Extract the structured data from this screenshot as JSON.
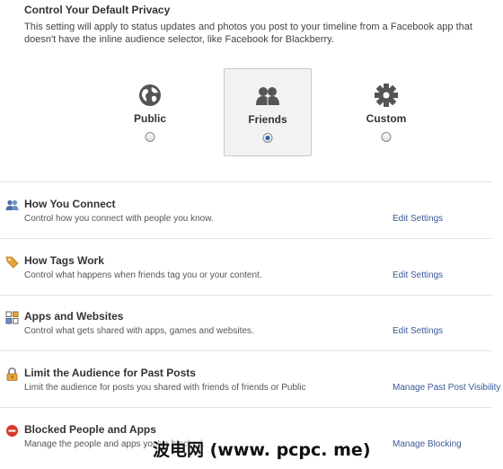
{
  "privacy": {
    "title": "Control Your Default Privacy",
    "description": "This setting will apply to status updates and photos you post to your timeline from a Facebook app that doesn't have the inline audience selector, like Facebook for Blackberry.",
    "options": [
      {
        "label": "Public",
        "icon": "globe-icon",
        "selected": false
      },
      {
        "label": "Friends",
        "icon": "friends-icon",
        "selected": true
      },
      {
        "label": "Custom",
        "icon": "gear-icon",
        "selected": false
      }
    ]
  },
  "sections": [
    {
      "title": "How You Connect",
      "description": "Control how you connect with people you know.",
      "link": "Edit Settings",
      "icon": "people-icon"
    },
    {
      "title": "How Tags Work",
      "description": "Control what happens when friends tag you or your content.",
      "link": "Edit Settings",
      "icon": "tag-icon"
    },
    {
      "title": "Apps and Websites",
      "description": "Control what gets shared with apps, games and websites.",
      "link": "Edit Settings",
      "icon": "apps-icon"
    },
    {
      "title": "Limit the Audience for Past Posts",
      "description": "Limit the audience for posts you shared with friends of friends or Public",
      "link": "Manage Past Post Visibility",
      "icon": "lock-icon"
    },
    {
      "title": "Blocked People and Apps",
      "description": "Manage the people and apps you've blocked.",
      "link": "Manage Blocking",
      "icon": "blocked-icon"
    }
  ],
  "watermark": "波电网 (www. pcpc. me)",
  "colors": {
    "link": "#3b5998",
    "selected_radio": "#2a61b5",
    "icon_gray": "#555555"
  }
}
